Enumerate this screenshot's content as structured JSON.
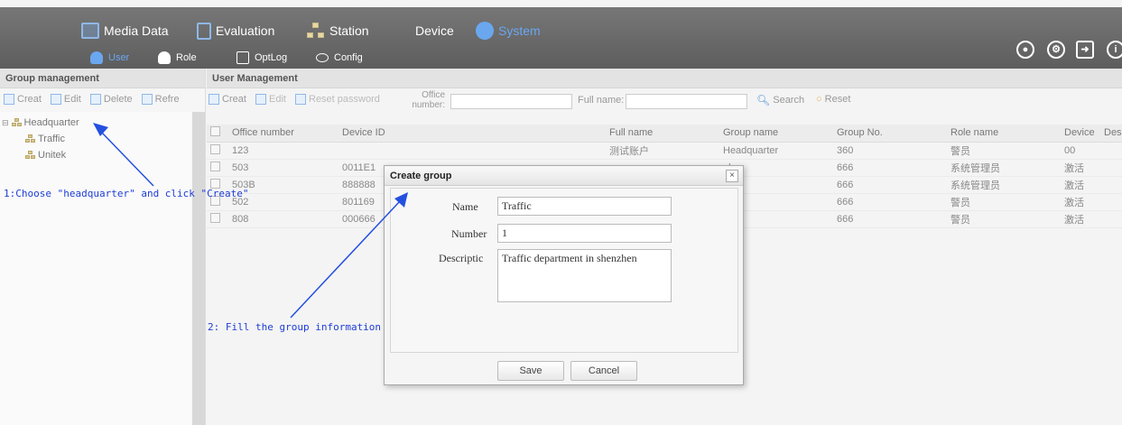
{
  "topnav": {
    "main": [
      "Media Data",
      "Evaluation",
      "Station",
      "Device",
      "System"
    ],
    "sub": [
      "User",
      "Role",
      "OptLog",
      "Config"
    ],
    "active_main": "System",
    "active_sub": "User",
    "accent": "#6aa7ef"
  },
  "group_panel": {
    "title": "Group management",
    "toolbar": [
      "Creat",
      "Edit",
      "Delete",
      "Refre"
    ],
    "tree": {
      "root": "Headquarter",
      "children": [
        "Traffic",
        "Unitek"
      ]
    }
  },
  "user_panel": {
    "title": "User Management",
    "toolbar": {
      "create": "Creat",
      "edit": "Edit",
      "reset_password": "Reset password",
      "office_label_1": "Office",
      "office_label_2": "number:",
      "fullname_label": "Full name:",
      "search": "Search",
      "reset": "Reset"
    },
    "columns": [
      "Office number",
      "Device ID",
      "Full name",
      "Group name",
      "Group No.",
      "Role name",
      "Device",
      "Des"
    ],
    "rows": [
      {
        "office": "123",
        "device_id": "",
        "full_name": "测试账户",
        "group": "Headquarter",
        "group_no": "360",
        "role": "警员",
        "device": "00"
      },
      {
        "office": "503",
        "device_id": "0011E1",
        "full_name": "",
        "group": "ek",
        "group_no": "666",
        "role": "系统管理员",
        "device": "激活"
      },
      {
        "office": "503B",
        "device_id": "888888",
        "full_name": "",
        "group": "ek",
        "group_no": "666",
        "role": "系统管理员",
        "device": "激活"
      },
      {
        "office": "502",
        "device_id": "801169",
        "full_name": "",
        "group": "ek",
        "group_no": "666",
        "role": "警员",
        "device": "激活"
      },
      {
        "office": "808",
        "device_id": "000666",
        "full_name": "",
        "group": "ek",
        "group_no": "666",
        "role": "警员",
        "device": "激活"
      }
    ]
  },
  "dialog": {
    "title": "Create group",
    "close": "×",
    "name_label": "Name",
    "name_value": "Traffic",
    "number_label": "Number",
    "number_value": "1",
    "desc_label": "Descriptic",
    "desc_value": "Traffic department in shenzhen",
    "save": "Save",
    "cancel": "Cancel"
  },
  "annotations": {
    "step1": "1:Choose \"headquarter\" and click \"Create\"",
    "step2": "2: Fill the group information",
    "color": "#1e3dd6"
  }
}
